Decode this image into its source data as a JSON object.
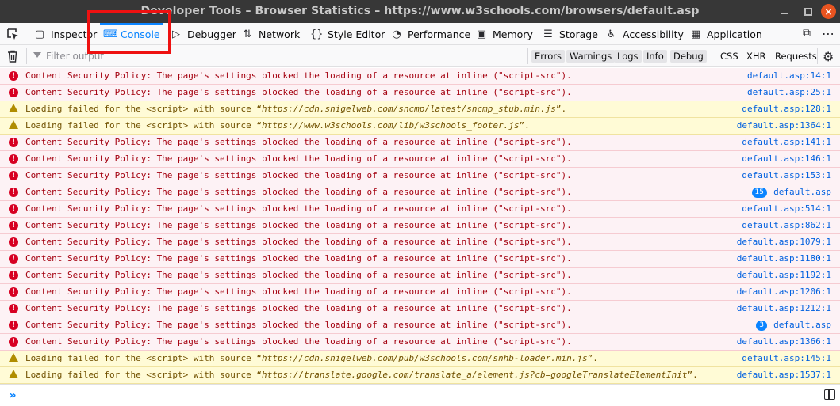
{
  "window": {
    "title": "Developer Tools – Browser Statistics – https://www.w3schools.com/browsers/default.asp",
    "close_glyph": "×"
  },
  "tabs": [
    {
      "label": "Inspector",
      "icon": "inspector-icon",
      "glyph": "▢"
    },
    {
      "label": "Console",
      "icon": "console-icon",
      "glyph": "⌨",
      "selected": true
    },
    {
      "label": "Debugger",
      "icon": "debugger-icon",
      "glyph": "▷"
    },
    {
      "label": "Network",
      "icon": "network-icon",
      "glyph": "⇅"
    },
    {
      "label": "Style Editor",
      "icon": "style-editor-icon",
      "glyph": "{}"
    },
    {
      "label": "Performance",
      "icon": "performance-icon",
      "glyph": "◔"
    },
    {
      "label": "Memory",
      "icon": "memory-icon",
      "glyph": "▣"
    },
    {
      "label": "Storage",
      "icon": "storage-icon",
      "glyph": "☰"
    },
    {
      "label": "Accessibility",
      "icon": "accessibility-icon",
      "glyph": "♿"
    },
    {
      "label": "Application",
      "icon": "application-icon",
      "glyph": "▦"
    }
  ],
  "toolbar": {
    "filter_placeholder": "Filter output",
    "filters": [
      "Errors",
      "Warnings",
      "Logs",
      "Info",
      "Debug"
    ],
    "toggles": [
      "CSS",
      "XHR",
      "Requests"
    ]
  },
  "colors": {
    "accent": "#0a84ff",
    "error_bg": "#fdf2f5",
    "error_text": "#a4000f",
    "warning_bg": "#fffbd6",
    "link": "#0060df",
    "highlight": "#ee1111"
  },
  "messages": [
    {
      "level": "error",
      "text": "Content Security Policy: The page's settings blocked the loading of a resource at inline (\"script-src\").",
      "location": "default.asp:14:1"
    },
    {
      "level": "error",
      "text": "Content Security Policy: The page's settings blocked the loading of a resource at inline (\"script-src\").",
      "location": "default.asp:25:1"
    },
    {
      "level": "warning",
      "text_pre": "Loading failed for the <script> with source “",
      "text_url": "https://cdn.snigelweb.com/sncmp/latest/sncmp_stub.min.js",
      "text_post": "”.",
      "location": "default.asp:128:1"
    },
    {
      "level": "warning",
      "text_pre": "Loading failed for the <script> with source “",
      "text_url": "https://www.w3schools.com/lib/w3schools_footer.js",
      "text_post": "”.",
      "location": "default.asp:1364:1"
    },
    {
      "level": "error",
      "text": "Content Security Policy: The page's settings blocked the loading of a resource at inline (\"script-src\").",
      "location": "default.asp:141:1"
    },
    {
      "level": "error",
      "text": "Content Security Policy: The page's settings blocked the loading of a resource at inline (\"script-src\").",
      "location": "default.asp:146:1"
    },
    {
      "level": "error",
      "text": "Content Security Policy: The page's settings blocked the loading of a resource at inline (\"script-src\").",
      "location": "default.asp:153:1"
    },
    {
      "level": "error",
      "text": "Content Security Policy: The page's settings blocked the loading of a resource at inline (\"script-src\").",
      "location": "default.asp",
      "repeat": "15"
    },
    {
      "level": "error",
      "text": "Content Security Policy: The page's settings blocked the loading of a resource at inline (\"script-src\").",
      "location": "default.asp:514:1"
    },
    {
      "level": "error",
      "text": "Content Security Policy: The page's settings blocked the loading of a resource at inline (\"script-src\").",
      "location": "default.asp:862:1"
    },
    {
      "level": "error",
      "text": "Content Security Policy: The page's settings blocked the loading of a resource at inline (\"script-src\").",
      "location": "default.asp:1079:1"
    },
    {
      "level": "error",
      "text": "Content Security Policy: The page's settings blocked the loading of a resource at inline (\"script-src\").",
      "location": "default.asp:1180:1"
    },
    {
      "level": "error",
      "text": "Content Security Policy: The page's settings blocked the loading of a resource at inline (\"script-src\").",
      "location": "default.asp:1192:1"
    },
    {
      "level": "error",
      "text": "Content Security Policy: The page's settings blocked the loading of a resource at inline (\"script-src\").",
      "location": "default.asp:1206:1"
    },
    {
      "level": "error",
      "text": "Content Security Policy: The page's settings blocked the loading of a resource at inline (\"script-src\").",
      "location": "default.asp:1212:1"
    },
    {
      "level": "error",
      "text": "Content Security Policy: The page's settings blocked the loading of a resource at inline (\"script-src\").",
      "location": "default.asp",
      "repeat": "3"
    },
    {
      "level": "error",
      "text": "Content Security Policy: The page's settings blocked the loading of a resource at inline (\"script-src\").",
      "location": "default.asp:1366:1"
    },
    {
      "level": "warning",
      "text_pre": "Loading failed for the <script> with source “",
      "text_url": "https://cdn.snigelweb.com/pub/w3schools.com/snhb-loader.min.js",
      "text_post": "”.",
      "location": "default.asp:145:1"
    },
    {
      "level": "warning",
      "text_pre": "Loading failed for the <script> with source “",
      "text_url": "https://translate.google.com/translate_a/element.js?cb=googleTranslateElementInit",
      "text_post": "”.",
      "location": "default.asp:1537:1"
    }
  ],
  "input": {
    "prompt": "»"
  }
}
